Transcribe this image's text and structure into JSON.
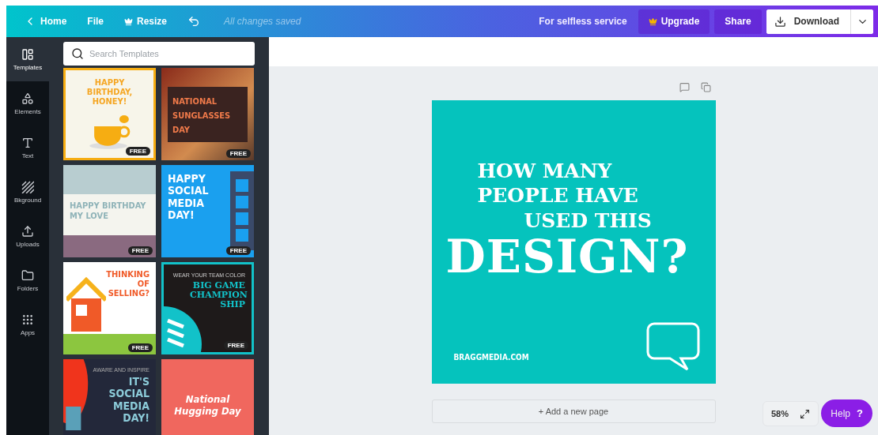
{
  "topbar": {
    "home": "Home",
    "file": "File",
    "resize": "Resize",
    "save_status": "All changes saved",
    "team": "For selfless service",
    "upgrade": "Upgrade",
    "share": "Share",
    "download": "Download"
  },
  "sidebar": {
    "items": [
      {
        "label": "Templates",
        "selected": true
      },
      {
        "label": "Elements",
        "selected": false
      },
      {
        "label": "Text",
        "selected": false
      },
      {
        "label": "Bkground",
        "selected": false
      },
      {
        "label": "Uploads",
        "selected": false
      },
      {
        "label": "Folders",
        "selected": false
      },
      {
        "label": "Apps",
        "selected": false
      }
    ]
  },
  "search": {
    "placeholder": "Search Templates"
  },
  "templates": [
    {
      "kind": "cup",
      "headline": "HAPPY BIRTHDAY, HONEY!",
      "badge": "FREE"
    },
    {
      "kind": "dark-photo",
      "headline": "NATIONAL SUNGLASSES DAY",
      "badge": "FREE"
    },
    {
      "kind": "landscape",
      "headline": "HAPPY BIRTHDAY MY LOVE",
      "badge": "FREE"
    },
    {
      "kind": "social",
      "headline": "HAPPY SOCIAL MEDIA DAY!",
      "badge": "FREE"
    },
    {
      "kind": "house",
      "headline": "THINKING OF SELLING?",
      "badge": "FREE"
    },
    {
      "kind": "football",
      "tagline": "WEAR YOUR TEAM COLOR",
      "headline": "BIG GAME CHAMPION SHIP",
      "badge": "FREE"
    },
    {
      "kind": "megaphone",
      "tagline": "AWARE AND INSPIRE",
      "headline": "IT'S SOCIAL MEDIA DAY!"
    },
    {
      "kind": "floral",
      "headline": "National Hugging Day"
    }
  ],
  "design": {
    "lines": [
      "HOW MANY",
      "PEOPLE HAVE",
      "USED THIS",
      "DESIGN?"
    ],
    "footer": "BRAGGMEDIA.COM"
  },
  "add_page": "+ Add a new page",
  "zoom": "58%",
  "help": {
    "label": "Help",
    "icon": "?"
  }
}
